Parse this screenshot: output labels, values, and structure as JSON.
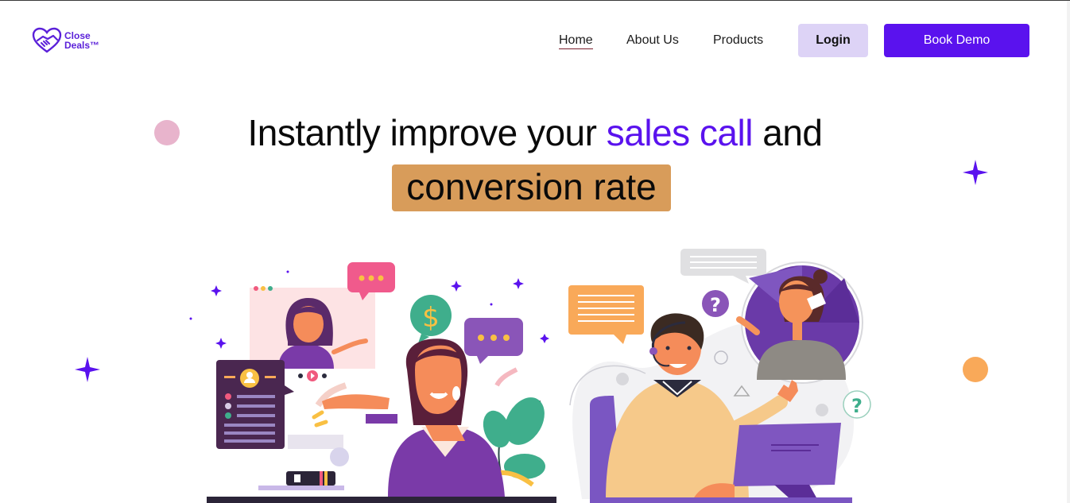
{
  "logo": {
    "line1": "Close",
    "line2": "Deals™"
  },
  "nav": {
    "items": [
      {
        "label": "Home",
        "active": true
      },
      {
        "label": "About Us",
        "active": false
      },
      {
        "label": "Products",
        "active": false
      }
    ],
    "login_label": "Login",
    "demo_label": "Book Demo"
  },
  "hero": {
    "headline_part1": "Instantly improve your ",
    "headline_highlight": "sales call",
    "headline_part2": " and",
    "headline_line2": "conversion rate"
  },
  "colors": {
    "brand_purple": "#5a12ee",
    "login_bg": "#ddd3f6",
    "highlight_bg": "#d89c5a",
    "pink_dot": "#e8b4cc",
    "orange_dot": "#f9a959"
  },
  "illustrations": {
    "left": "video-call-saleswoman-illustration",
    "right": "support-agent-phone-call-illustration"
  }
}
